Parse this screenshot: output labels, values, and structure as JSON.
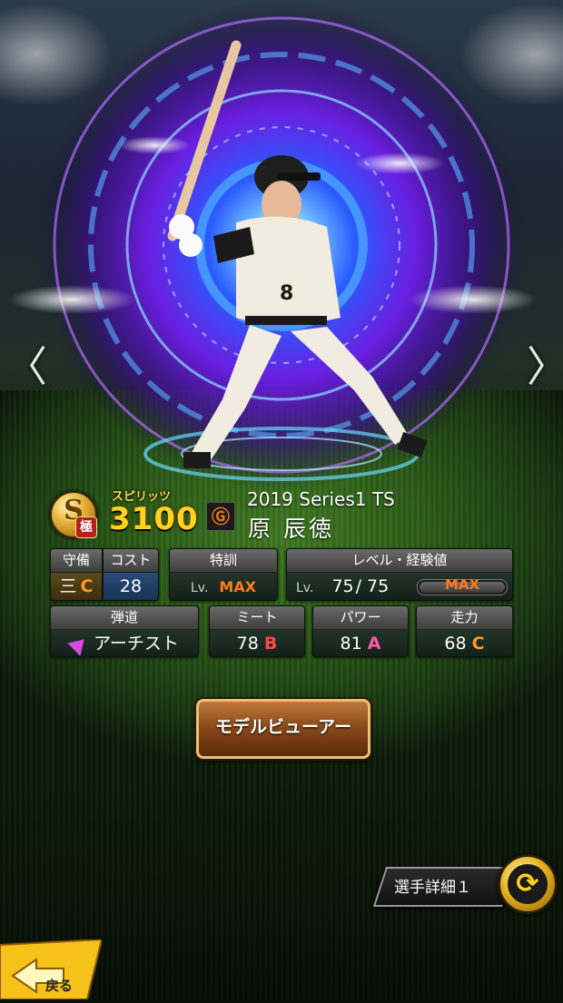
{
  "navigation": {
    "prev_glyph": "〈",
    "next_glyph": "〉"
  },
  "player": {
    "rank_letter": "S",
    "rank_sub": "極",
    "spirits_label": "スピリッツ",
    "spirits_value": "3100",
    "series": "2019 Series1 TS",
    "name": "原 辰徳",
    "team_logo_glyph": "Ⓖ"
  },
  "stats": {
    "defense": {
      "label": "守備",
      "position": "三",
      "grade": "C"
    },
    "cost": {
      "label": "コスト",
      "value": "28"
    },
    "special_training": {
      "label": "特訓",
      "lv_prefix": "Lv.",
      "value": "MAX"
    },
    "level": {
      "label": "レベル・経験値",
      "lv_prefix": "Lv.",
      "current": "75",
      "separator": "/",
      "max": "75",
      "exp_label": "MAX",
      "exp_progress": 1.0
    },
    "trajectory": {
      "label": "弾道",
      "value": "アーチスト"
    },
    "contact": {
      "label": "ミート",
      "value": "78",
      "grade": "B"
    },
    "power": {
      "label": "パワー",
      "value": "81",
      "grade": "A"
    },
    "speed": {
      "label": "走力",
      "value": "68",
      "grade": "C"
    }
  },
  "buttons": {
    "model_viewer": "モデルビューアー",
    "player_detail": "選手詳細１",
    "back": "戻る"
  },
  "colors": {
    "grade_c": "#ff9a2a",
    "grade_b": "#ff4848",
    "grade_a": "#ff5aa8",
    "max": "#ff7a1a",
    "spirits": "#ffd21d"
  }
}
